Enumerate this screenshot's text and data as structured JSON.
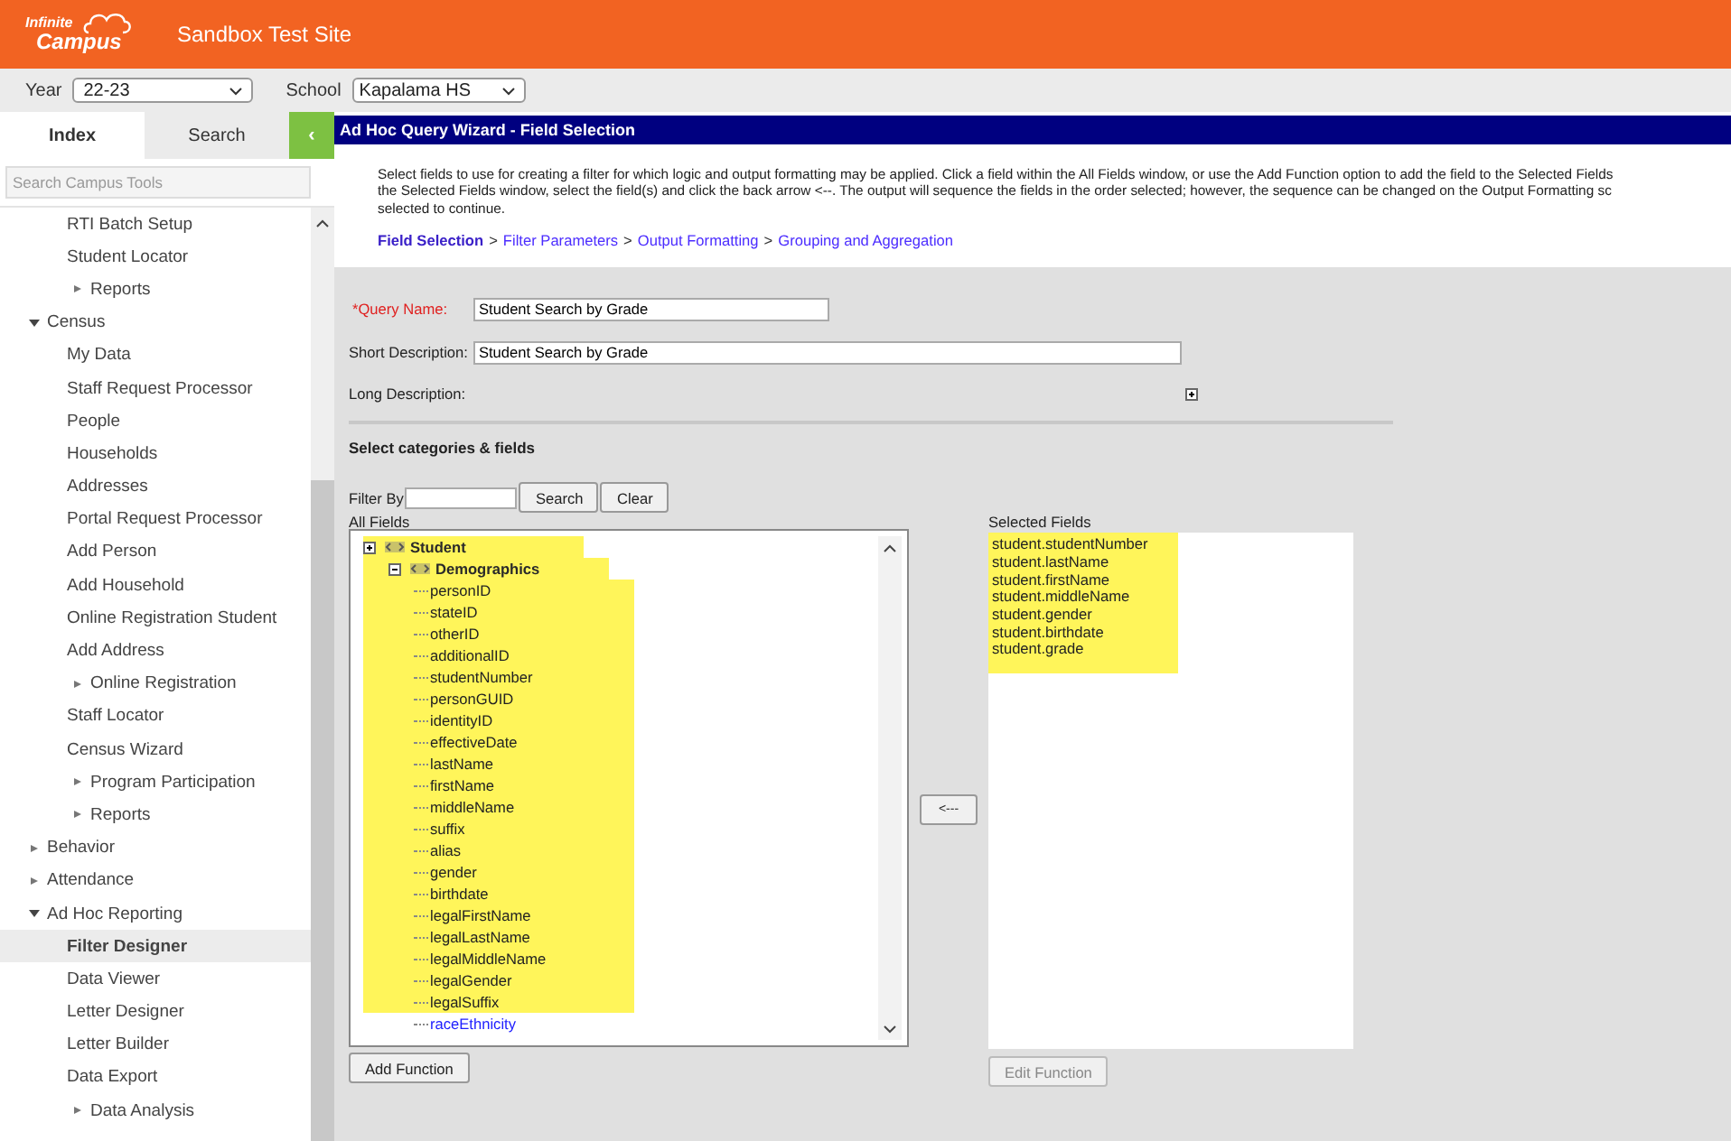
{
  "header": {
    "logo_top": "Infinite",
    "logo_bottom": "Campus",
    "site": "Sandbox Test Site"
  },
  "context_bar": {
    "year_label": "Year",
    "year": "22-23",
    "school_label": "School",
    "school": "Kapalama HS"
  },
  "sidebar": {
    "tabs": [
      {
        "label": "Index",
        "selected": true
      },
      {
        "label": "Search",
        "selected": false
      }
    ],
    "collapse_glyph": "‹",
    "search": {
      "placeholder": "Search Campus Tools"
    },
    "items": [
      {
        "children": [
          {
            "label": "RTI Batch Setup"
          },
          {
            "label": "Student Locator"
          },
          {
            "label": "Reports",
            "expanded": false
          }
        ]
      },
      {
        "label": "Census",
        "expanded": true,
        "children": [
          {
            "label": "My Data"
          },
          {
            "label": "Staff Request Processor"
          },
          {
            "label": "People"
          },
          {
            "label": "Households"
          },
          {
            "label": "Addresses"
          },
          {
            "label": "Portal Request Processor"
          },
          {
            "label": "Add Person"
          },
          {
            "label": "Add Household"
          },
          {
            "label": "Online Registration Student"
          },
          {
            "label": "Add Address"
          },
          {
            "label": "Online Registration",
            "expanded": false
          },
          {
            "label": "Staff Locator"
          },
          {
            "label": "Census Wizard"
          },
          {
            "label": "Program Participation",
            "expanded": false
          },
          {
            "label": "Reports",
            "expanded": false
          }
        ]
      },
      {
        "label": "Behavior",
        "expanded": false
      },
      {
        "label": "Attendance",
        "expanded": false
      },
      {
        "label": "Ad Hoc Reporting",
        "expanded": true,
        "children": [
          {
            "label": "Filter Designer",
            "selected": true
          },
          {
            "label": "Data Viewer",
            "selected": false
          },
          {
            "label": "Letter Designer",
            "selected": false
          },
          {
            "label": "Letter Builder",
            "selected": false
          },
          {
            "label": "Data Export",
            "selected": false
          },
          {
            "label": "Data Analysis",
            "expanded": false
          }
        ]
      }
    ]
  },
  "main": {
    "title": "Ad Hoc Query Wizard - Field Selection",
    "intro_lines": [
      "Select fields to use for creating a filter for which logic and output formatting may be applied. Click a field within the All Fields window, or use the Add Function option to add the field to the Selected Fields",
      "the Selected Fields window, select the field(s) and click the back arrow <--. The output will sequence the fields in the order selected; however, the sequence can be changed on the Output Formatting sc",
      "selected to continue."
    ],
    "steps": [
      {
        "label": "Field Selection",
        "selected": true
      },
      {
        "label": "Filter Parameters",
        "selected": false
      },
      {
        "label": "Output Formatting",
        "selected": false
      },
      {
        "label": "Grouping and Aggregation",
        "selected": false
      }
    ],
    "step_separator": ">",
    "query_name": {
      "label": "*Query Name:",
      "value": "Student Search by Grade",
      "required": true
    },
    "short_description": {
      "label": "Short Description:",
      "value": "Student Search by Grade"
    },
    "long_description": {
      "label": "Long Description:",
      "expanded": false
    },
    "section_title": "Select categories & fields",
    "filter": {
      "label": "Filter By",
      "search_button": "Search",
      "clear_button": "Clear"
    },
    "all_fields": {
      "label": "All Fields",
      "tree": [
        {
          "label": "Student",
          "expanded": false,
          "highlighted": true,
          "children": [
            {
              "label": "Demographics",
              "expanded": true,
              "highlighted": true,
              "children": [
                {
                  "label": "personID",
                  "highlighted": true
                },
                {
                  "label": "stateID",
                  "highlighted": true
                },
                {
                  "label": "otherID",
                  "highlighted": true
                },
                {
                  "label": "additionalID",
                  "highlighted": true
                },
                {
                  "label": "studentNumber",
                  "highlighted": true
                },
                {
                  "label": "personGUID",
                  "highlighted": true
                },
                {
                  "label": "identityID",
                  "highlighted": true
                },
                {
                  "label": "effectiveDate",
                  "highlighted": true
                },
                {
                  "label": "lastName",
                  "highlighted": true
                },
                {
                  "label": "firstName",
                  "highlighted": true
                },
                {
                  "label": "middleName",
                  "highlighted": true
                },
                {
                  "label": "suffix",
                  "highlighted": true
                },
                {
                  "label": "alias",
                  "highlighted": true
                },
                {
                  "label": "gender",
                  "highlighted": true
                },
                {
                  "label": "birthdate",
                  "highlighted": true
                },
                {
                  "label": "legalFirstName",
                  "highlighted": true
                },
                {
                  "label": "legalLastName",
                  "highlighted": true
                },
                {
                  "label": "legalMiddleName",
                  "highlighted": true
                },
                {
                  "label": "legalGender",
                  "highlighted": true
                },
                {
                  "label": "legalSuffix",
                  "highlighted": true
                },
                {
                  "label": "raceEthnicity",
                  "highlighted": false
                }
              ]
            }
          ]
        }
      ],
      "add_button": "Add Function"
    },
    "back_button": "<---",
    "selected_fields": {
      "label": "Selected Fields",
      "highlighted": true,
      "items": [
        "student.studentNumber",
        "student.lastName",
        "student.firstName",
        "student.middleName",
        "student.gender",
        "student.birthdate",
        "student.grade"
      ],
      "edit_button": "Edit Function",
      "edit_disabled": true
    }
  }
}
